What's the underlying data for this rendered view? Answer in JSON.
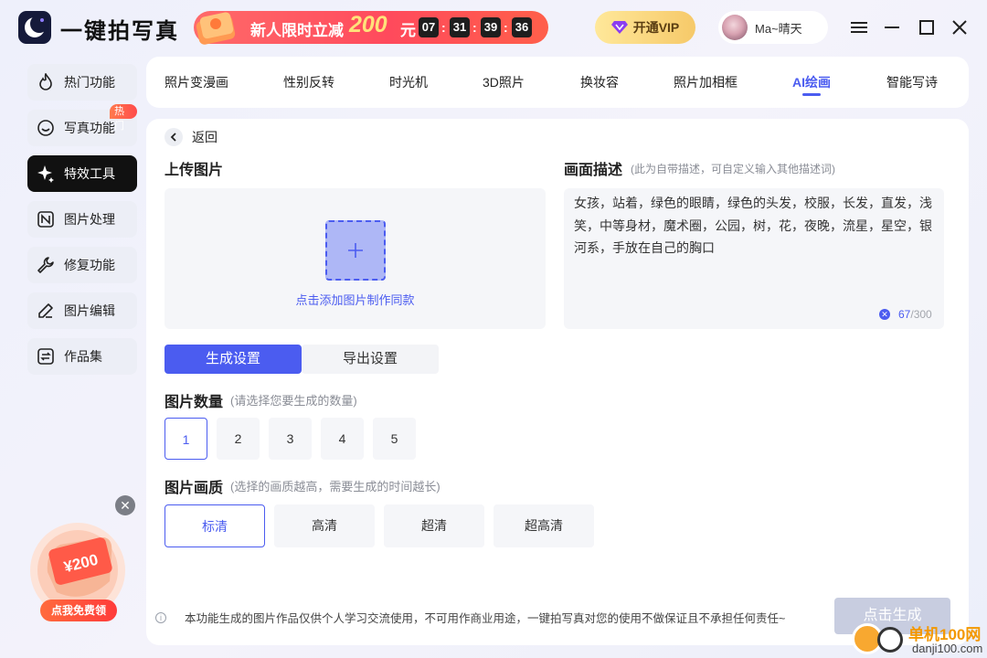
{
  "app": {
    "title": "一键拍写真"
  },
  "promo": {
    "text": "新人限时立减",
    "amount": "200",
    "unit": "元",
    "countdown": [
      "07",
      "31",
      "39",
      "36"
    ]
  },
  "header": {
    "vip_label": "开通VIP",
    "username": "Ma~晴天"
  },
  "sidebar": {
    "items": [
      {
        "label": "热门功能",
        "icon": "flame-icon"
      },
      {
        "label": "写真功能",
        "icon": "smile-icon",
        "badge": "热门"
      },
      {
        "label": "特效工具",
        "icon": "sparkle-icon",
        "active": true
      },
      {
        "label": "图片处理",
        "icon": "image-process-icon"
      },
      {
        "label": "修复功能",
        "icon": "wrench-icon"
      },
      {
        "label": "图片编辑",
        "icon": "edit-icon"
      },
      {
        "label": "作品集",
        "icon": "album-icon"
      }
    ],
    "coupon": {
      "amount": "¥200",
      "button": "点我免费领"
    }
  },
  "tabs": [
    "照片变漫画",
    "性别反转",
    "时光机",
    "3D照片",
    "换妆容",
    "照片加相框",
    "AI绘画",
    "智能写诗"
  ],
  "active_tab": "AI绘画",
  "main": {
    "back_label": "返回",
    "upload": {
      "title": "上传图片",
      "hint": "点击添加图片制作同款"
    },
    "description": {
      "title": "画面描述",
      "subtitle": "(此为自带描述，可自定义输入其他描述词)",
      "text": "女孩，站着，绿色的眼睛，绿色的头发，校服，长发，直发，浅笑，中等身材，魔术圈，公园，树，花，夜晚，流星，星空，银河系，手放在自己的胸口",
      "count": "67",
      "max": "/300"
    },
    "settings_tabs": [
      "生成设置",
      "导出设置"
    ],
    "count": {
      "title": "图片数量",
      "subtitle": "(请选择您要生成的数量)",
      "options": [
        "1",
        "2",
        "3",
        "4",
        "5"
      ],
      "selected": "1"
    },
    "quality": {
      "title": "图片画质",
      "subtitle": "(选择的画质越高，需要生成的时间越长)",
      "options": [
        "标清",
        "高清",
        "超清",
        "超高清"
      ],
      "selected": "标清"
    },
    "disclaimer": "本功能生成的图片作品仅供个人学习交流使用，不可用作商业用途，一键拍写真对您的使用不做保证且不承担任何责任~",
    "generate_label": "点击生成"
  },
  "watermark": {
    "line1": "单机100网",
    "line2": "danji100.com"
  },
  "colors": {
    "accent": "#4b5cf0",
    "promo": "#ff4a5c",
    "vip_gold": "#f6c969",
    "sidebar_active": "#111111"
  }
}
